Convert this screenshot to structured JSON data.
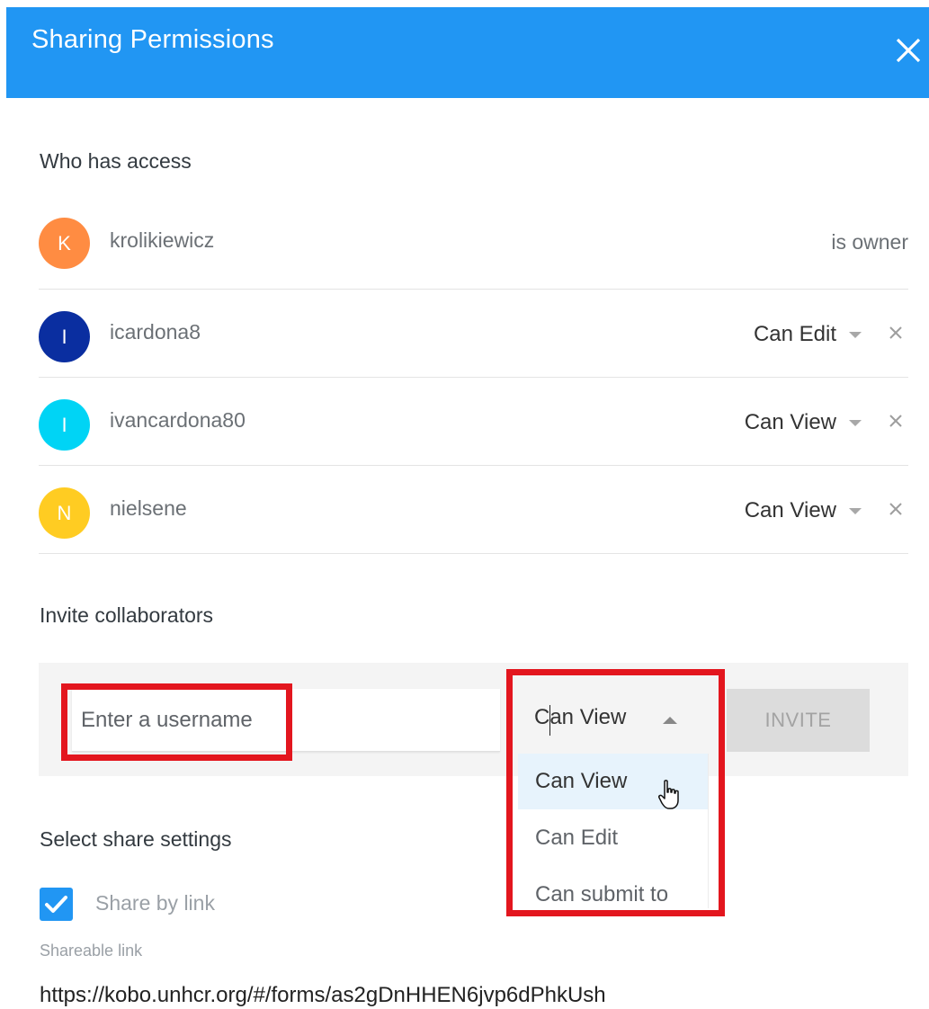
{
  "header": {
    "title": "Sharing Permissions"
  },
  "access": {
    "title": "Who has access",
    "users": [
      {
        "initial": "K",
        "name": "krolikiewicz",
        "role": "is owner",
        "color": "#ff8c42"
      },
      {
        "initial": "I",
        "name": "icardona8",
        "role": "Can Edit",
        "color": "#0a2ea0"
      },
      {
        "initial": "I",
        "name": "ivancardona80",
        "role": "Can View",
        "color": "#00d4f5"
      },
      {
        "initial": "N",
        "name": "nielsene",
        "role": "Can View",
        "color": "#ffcc22"
      }
    ]
  },
  "invite": {
    "title": "Invite collaborators",
    "username_placeholder": "Enter a username",
    "selected_permission": "Can View",
    "button_label": "INVITE",
    "options": [
      "Can View",
      "Can Edit",
      "Can submit to"
    ]
  },
  "share": {
    "title": "Select share settings",
    "share_by_link_label": "Share by link",
    "share_by_link_checked": true,
    "shareable_link_label": "Shareable link",
    "link": "https://kobo.unhcr.org/#/forms/as2gDnHHEN6jvp6dPhkUsh"
  },
  "colors": {
    "header": "#2196f3",
    "highlight": "#e3161e",
    "checkbox": "#2196f3"
  }
}
